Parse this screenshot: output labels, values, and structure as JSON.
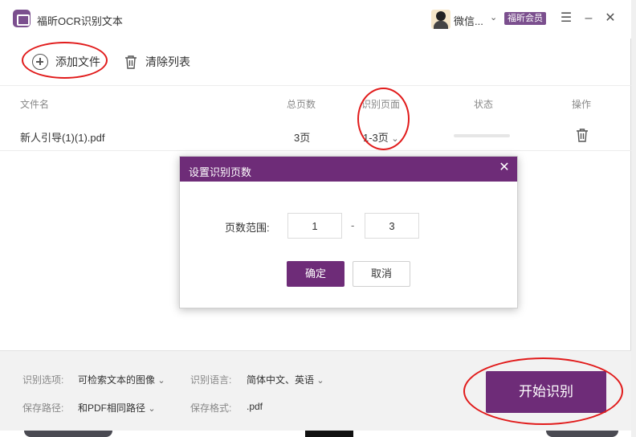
{
  "app": {
    "title": "福昕OCR识别文本",
    "username": "微信...",
    "vip_label": "福昕会员"
  },
  "toolbar": {
    "add_file_label": "添加文件",
    "clear_list_label": "清除列表"
  },
  "table": {
    "headers": {
      "filename": "文件名",
      "total_pages": "总页数",
      "recognize_pages": "识别页面",
      "status": "状态",
      "action": "操作"
    },
    "rows": [
      {
        "filename": "新人引导(1)(1).pdf",
        "total_pages": "3页",
        "recognize_pages": "1-3页",
        "progress": 0
      }
    ]
  },
  "dialog": {
    "title": "设置识别页数",
    "range_label": "页数范围:",
    "from_value": "1",
    "separator": "-",
    "to_value": "3",
    "ok_label": "确定",
    "cancel_label": "取消"
  },
  "bottom": {
    "recognize_option_label": "识别选项:",
    "recognize_option_value": "可检索文本的图像",
    "language_label": "识别语言:",
    "language_value": "简体中文、英语",
    "save_path_label": "保存路径:",
    "save_path_value": "和PDF相同路径",
    "save_format_label": "保存格式:",
    "save_format_value": ".pdf",
    "start_label": "开始识别"
  },
  "colors": {
    "accent": "#6e2c78",
    "annotation_red": "#e11b1b"
  }
}
